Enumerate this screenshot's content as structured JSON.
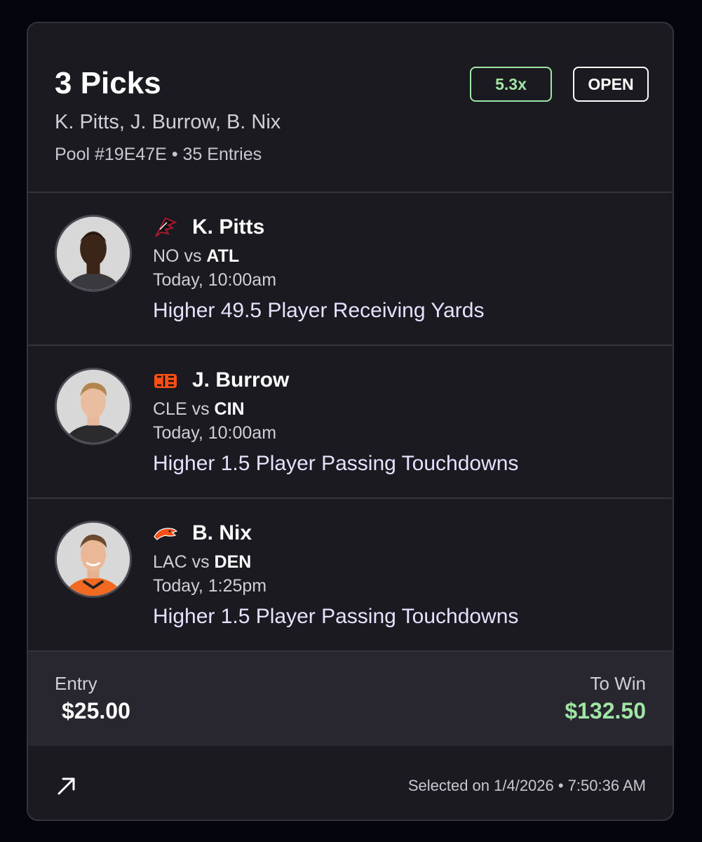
{
  "header": {
    "title": "3 Picks",
    "players": "K. Pitts, J. Burrow, B. Nix",
    "pool_id": "Pool #19E47E",
    "separator": "•",
    "entries": "35 Entries",
    "multiplier": "5.3x",
    "status": "OPEN"
  },
  "picks": [
    {
      "name": "K. Pitts",
      "team_icon": "falcons-logo-icon",
      "away": "NO",
      "vs": "vs",
      "home": "ATL",
      "time": "Today, 10:00am",
      "line": "Higher 49.5 Player Receiving Yards"
    },
    {
      "name": "J. Burrow",
      "team_icon": "bengals-logo-icon",
      "away": "CLE",
      "vs": "vs",
      "home": "CIN",
      "time": "Today, 10:00am",
      "line": "Higher 1.5 Player Passing Touchdowns"
    },
    {
      "name": "B. Nix",
      "team_icon": "broncos-logo-icon",
      "away": "LAC",
      "vs": "vs",
      "home": "DEN",
      "time": "Today, 1:25pm",
      "line": "Higher 1.5 Player Passing Touchdowns"
    }
  ],
  "totals": {
    "entry_label": "Entry",
    "entry_value": "$25.00",
    "towin_label": "To Win",
    "towin_value": "$132.50"
  },
  "footer": {
    "share_icon": "arrow-up-right-icon",
    "selected_text": "Selected on 1/4/2026 • 7:50:36 AM"
  },
  "colors": {
    "background": "#05060d",
    "card": "#1c1a21",
    "border": "#34323a",
    "accent_green": "#9fe6a5",
    "totals_bg": "#28262e"
  }
}
